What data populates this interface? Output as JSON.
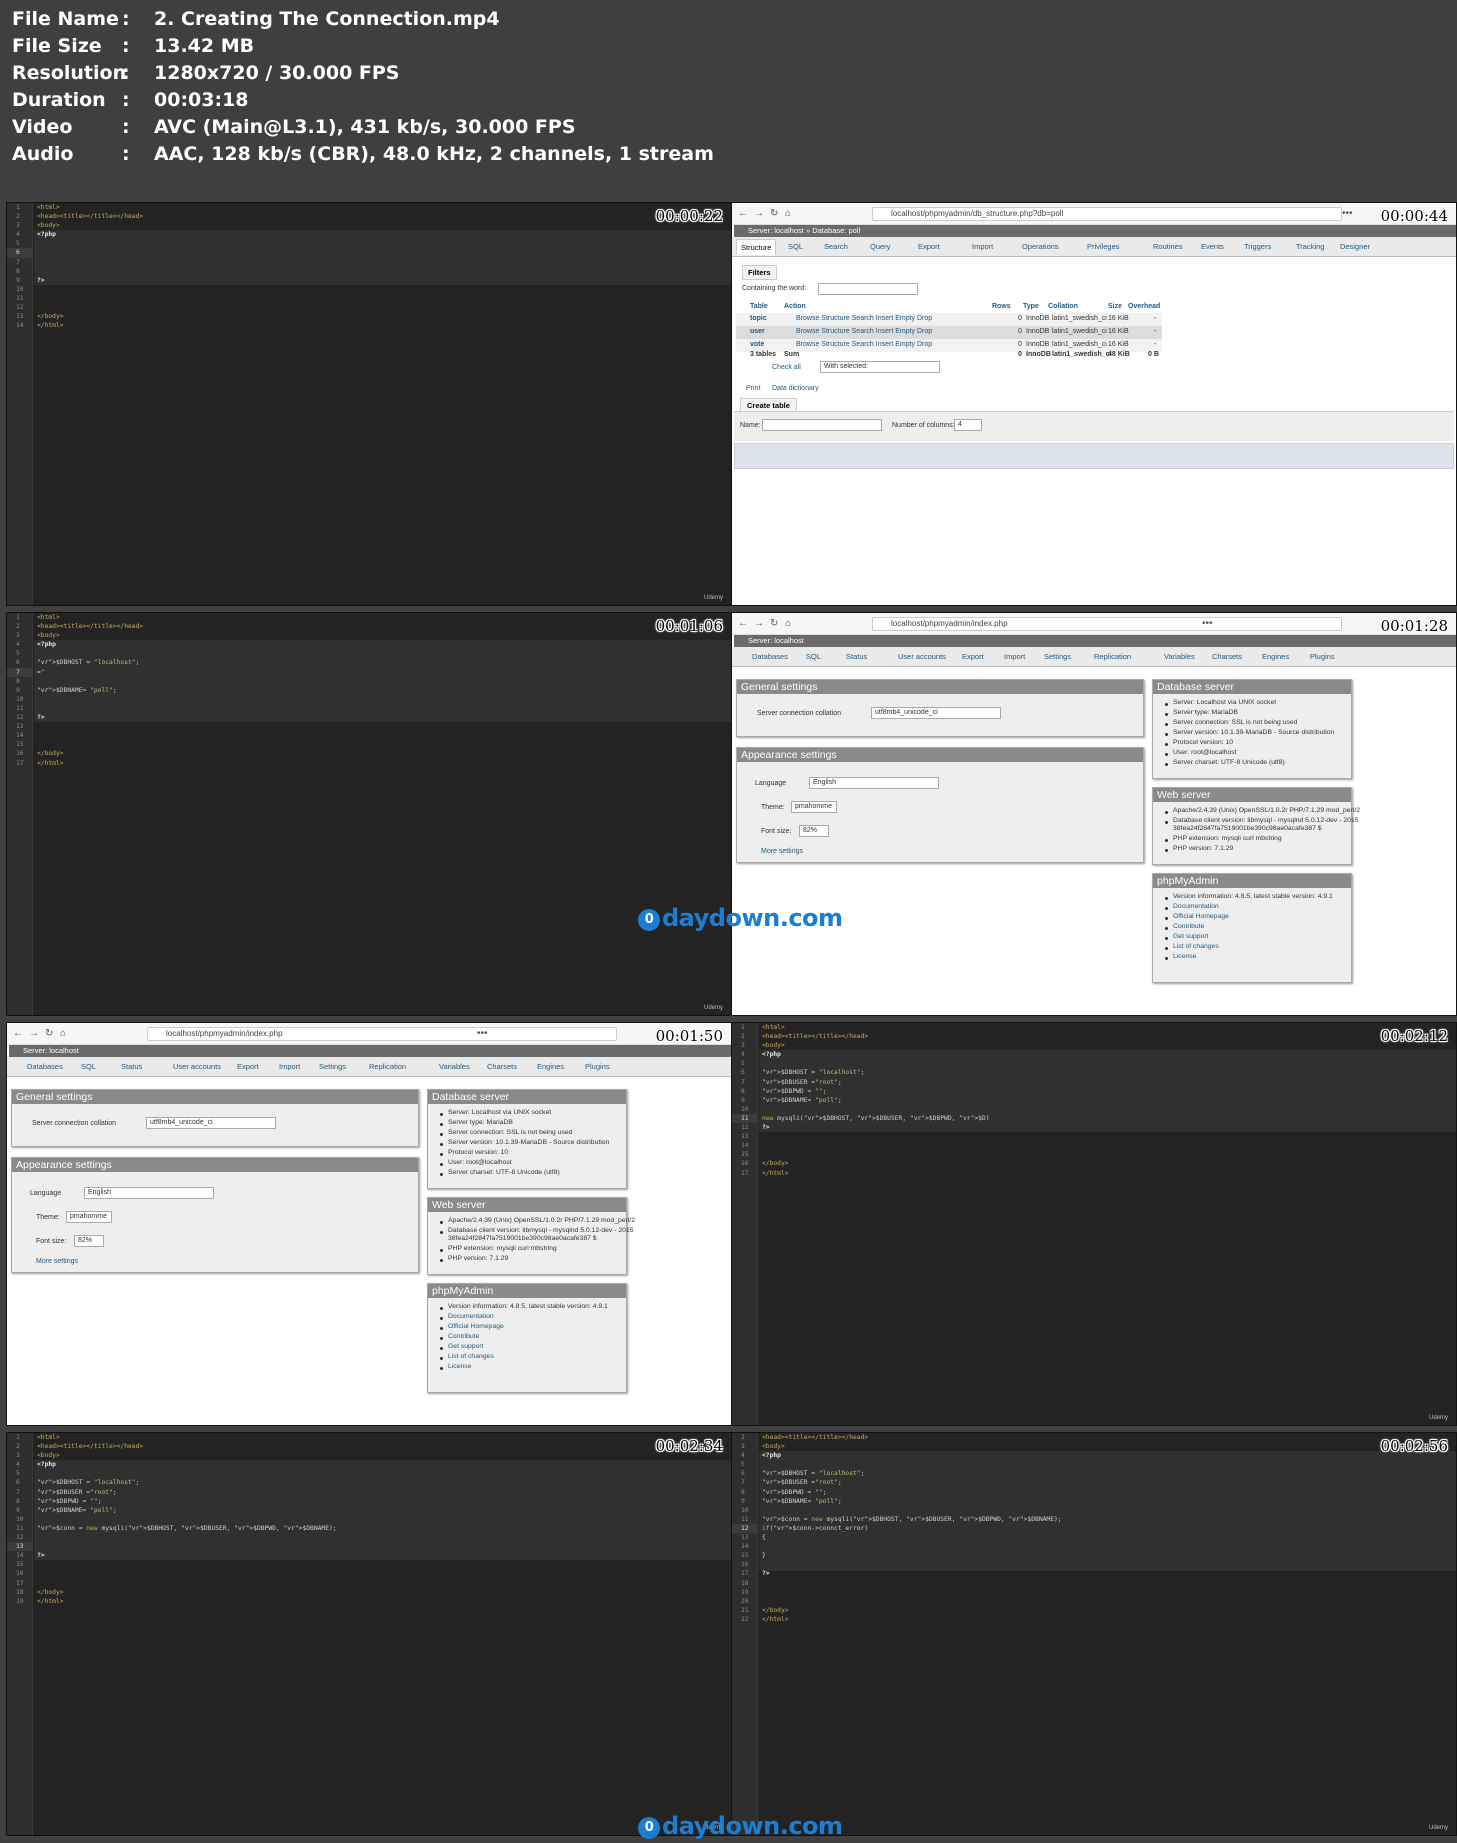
{
  "info": [
    {
      "k": "File Name",
      "v": "2. Creating The Connection.mp4"
    },
    {
      "k": "File Size",
      "v": "13.42 MB"
    },
    {
      "k": "Resolution",
      "v": "1280x720 / 30.000 FPS"
    },
    {
      "k": "Duration",
      "v": "00:03:18"
    },
    {
      "k": "Video",
      "v": "AVC (Main@L3.1), 431 kb/s, 30.000 FPS"
    },
    {
      "k": "Audio",
      "v": "AAC, 128 kb/s (CBR), 48.0 kHz, 2 channels, 1 stream"
    }
  ],
  "sep": ":",
  "timestamps": [
    "00:00:22",
    "00:00:44",
    "00:01:06",
    "00:01:28",
    "00:01:50",
    "00:02:12",
    "00:02:34",
    "00:02:56"
  ],
  "watermark": {
    "glyph": "0",
    "text": "daydown.com"
  },
  "udemy": "Udemy",
  "code": {
    "t1": [
      "<html>",
      "<head><title></title></head>",
      "<body>",
      "<?php",
      "",
      "",
      "",
      "",
      "?>",
      "",
      "",
      "",
      "</body>",
      "</html>"
    ],
    "t3": [
      "<html>",
      "<head><title></title></head>",
      "<body>",
      "<?php",
      "",
      "$DBHOST = \"localhost\";",
      "=\"",
      "",
      "$DBNAME= \"poll\";",
      "",
      "",
      "?>",
      "",
      "",
      "",
      "</body>",
      "</html>"
    ],
    "t6": [
      "<html>",
      "<head><title></title></head>",
      "<body>",
      "<?php",
      "",
      "$DBHOST = \"localhost\";",
      "$DBUSER =\"root\";",
      "$DBPWD = \"\";",
      "$DBNAME= \"poll\";",
      "",
      "new mysqli($DBHOST, $DBUSER, $DBPWD, $D)",
      "?>",
      "",
      "",
      "",
      "</body>",
      "</html>"
    ],
    "t7": [
      "<html>",
      "<head><title></title></head>",
      "<body>",
      "<?php",
      "",
      "$DBHOST = \"localhost\";",
      "$DBUSER =\"root\";",
      "$DBPWD = \"\";",
      "$DBNAME= \"poll\";",
      "",
      "$conn = new mysqli($DBHOST, $DBUSER, $DBPWD, $DBNAME);",
      "",
      "",
      "?>",
      "",
      "",
      "",
      "</body>",
      "</html>"
    ],
    "t8": [
      "<head><title></title></head>",
      "<body>",
      "<?php",
      "",
      "$DBHOST = \"localhost\";",
      "$DBUSER =\"root\";",
      "$DBPWD = \"\";",
      "$DBNAME= \"poll\";",
      "",
      "$conn = new mysqli($DBHOST, $DBUSER, $DBPWD, $DBNAME);",
      "if($conn->connct_error)",
      "{",
      "",
      "}",
      "",
      "?>",
      "",
      "",
      "",
      "</body>",
      "</html>"
    ]
  },
  "gut": {
    "t1": [
      "1",
      "2",
      "3",
      "4",
      "5",
      "6",
      "7",
      "8",
      "9",
      "10",
      "11",
      "12",
      "13",
      "14"
    ],
    "t3": [
      "1",
      "2",
      "3",
      "4",
      "5",
      "6",
      "7",
      "8",
      "9",
      "10",
      "11",
      "12",
      "13",
      "14",
      "15",
      "16",
      "17"
    ],
    "t6": [
      "1",
      "2",
      "3",
      "4",
      "5",
      "6",
      "7",
      "8",
      "9",
      "10",
      "11",
      "12",
      "13",
      "14",
      "15",
      "16",
      "17"
    ],
    "t7": [
      "1",
      "2",
      "3",
      "4",
      "5",
      "6",
      "7",
      "8",
      "9",
      "10",
      "11",
      "12",
      "13",
      "14",
      "15",
      "16",
      "17",
      "18",
      "19"
    ],
    "t8": [
      "2",
      "3",
      "4",
      "5",
      "6",
      "7",
      "8",
      "9",
      "10",
      "11",
      "12",
      "13",
      "14",
      "15",
      "16",
      "17",
      "18",
      "19",
      "20",
      "21",
      "22"
    ]
  },
  "db": {
    "url": "localhost/phpmyadmin/db_structure.php?db=poll",
    "crumb": "Server: localhost » Database: poll",
    "tabs": [
      "Structure",
      "SQL",
      "Search",
      "Query",
      "Export",
      "Import",
      "Operations",
      "Privileges",
      "Routines",
      "Events",
      "Triggers",
      "Tracking",
      "Designer"
    ],
    "filters": "Filters",
    "containing": "Containing the word:",
    "cols": [
      "Table",
      "Action",
      "Rows",
      "Type",
      "Collation",
      "Size",
      "Overhead"
    ],
    "rows": [
      {
        "name": "topic",
        "rows": "0",
        "type": "InnoDB",
        "coll": "latin1_swedish_ci",
        "size": "16 KiB",
        "oh": "-"
      },
      {
        "name": "user",
        "rows": "0",
        "type": "InnoDB",
        "coll": "latin1_swedish_ci",
        "size": "16 KiB",
        "oh": "-"
      },
      {
        "name": "vote",
        "rows": "0",
        "type": "InnoDB",
        "coll": "latin1_swedish_ci",
        "size": "16 KiB",
        "oh": "-"
      }
    ],
    "actions": "Browse  Structure  Search  Insert  Empty  Drop",
    "sum": {
      "name": "3 tables",
      "label": "Sum",
      "rows": "0",
      "type": "InnoDB",
      "coll": "latin1_swedish_ci",
      "size": "48 KiB",
      "oh": "0 B"
    },
    "checkall": "Check all",
    "withsel": "With selected:",
    "print": "Print",
    "dict": "Data dictionary",
    "create": "Create table",
    "name": "Name:",
    "numcols": "Number of columns:",
    "numval": "4"
  },
  "idx": {
    "url": "localhost/phpmyadmin/index.php",
    "crumb": "Server: localhost",
    "tabs": [
      "Databases",
      "SQL",
      "Status",
      "User accounts",
      "Export",
      "Import",
      "Settings",
      "Replication",
      "Variables",
      "Charsets",
      "Engines",
      "Plugins"
    ],
    "general": "General settings",
    "collation_lbl": "Server connection collation",
    "collation": "utf8mb4_unicode_ci",
    "appearance": "Appearance settings",
    "lang_lbl": "Language",
    "lang": "English",
    "theme_lbl": "Theme:",
    "theme": "pmahomme",
    "font_lbl": "Font size:",
    "font": "82%",
    "more": "More settings",
    "dbserver": "Database server",
    "dbitems": [
      "Server: Localhost via UNIX socket",
      "Server type: MariaDB",
      "Server connection: SSL is not being used",
      "Server version: 10.1.39-MariaDB - Source distribution",
      "Protocol version: 10",
      "User: root@localhost",
      "Server charset: UTF-8 Unicode (utf8)"
    ],
    "web": "Web server",
    "webitems": [
      "Apache/2.4.39 (Unix) OpenSSL/1.0.2r PHP/7.1.29 mod_perl/2",
      "Database client version: libmysql - mysqlnd 5.0.12-dev - 2015",
      "38fea24f2847fa7519001be390c98ae0acafe387 $",
      "PHP extension: mysqli  curl  mbstring",
      "PHP version: 7.1.29"
    ],
    "pma": "phpMyAdmin",
    "pmaitems": [
      "Version information: 4.8.5, latest stable version: 4.9.1",
      "Documentation",
      "Official Homepage",
      "Contribute",
      "Get support",
      "List of changes",
      "License"
    ]
  },
  "colors": {
    "header": "#3f3f3f",
    "editor": "#232323",
    "pma_legend": "#8a8a8a",
    "link": "#235a81",
    "watermark": "#1a7fd4"
  }
}
